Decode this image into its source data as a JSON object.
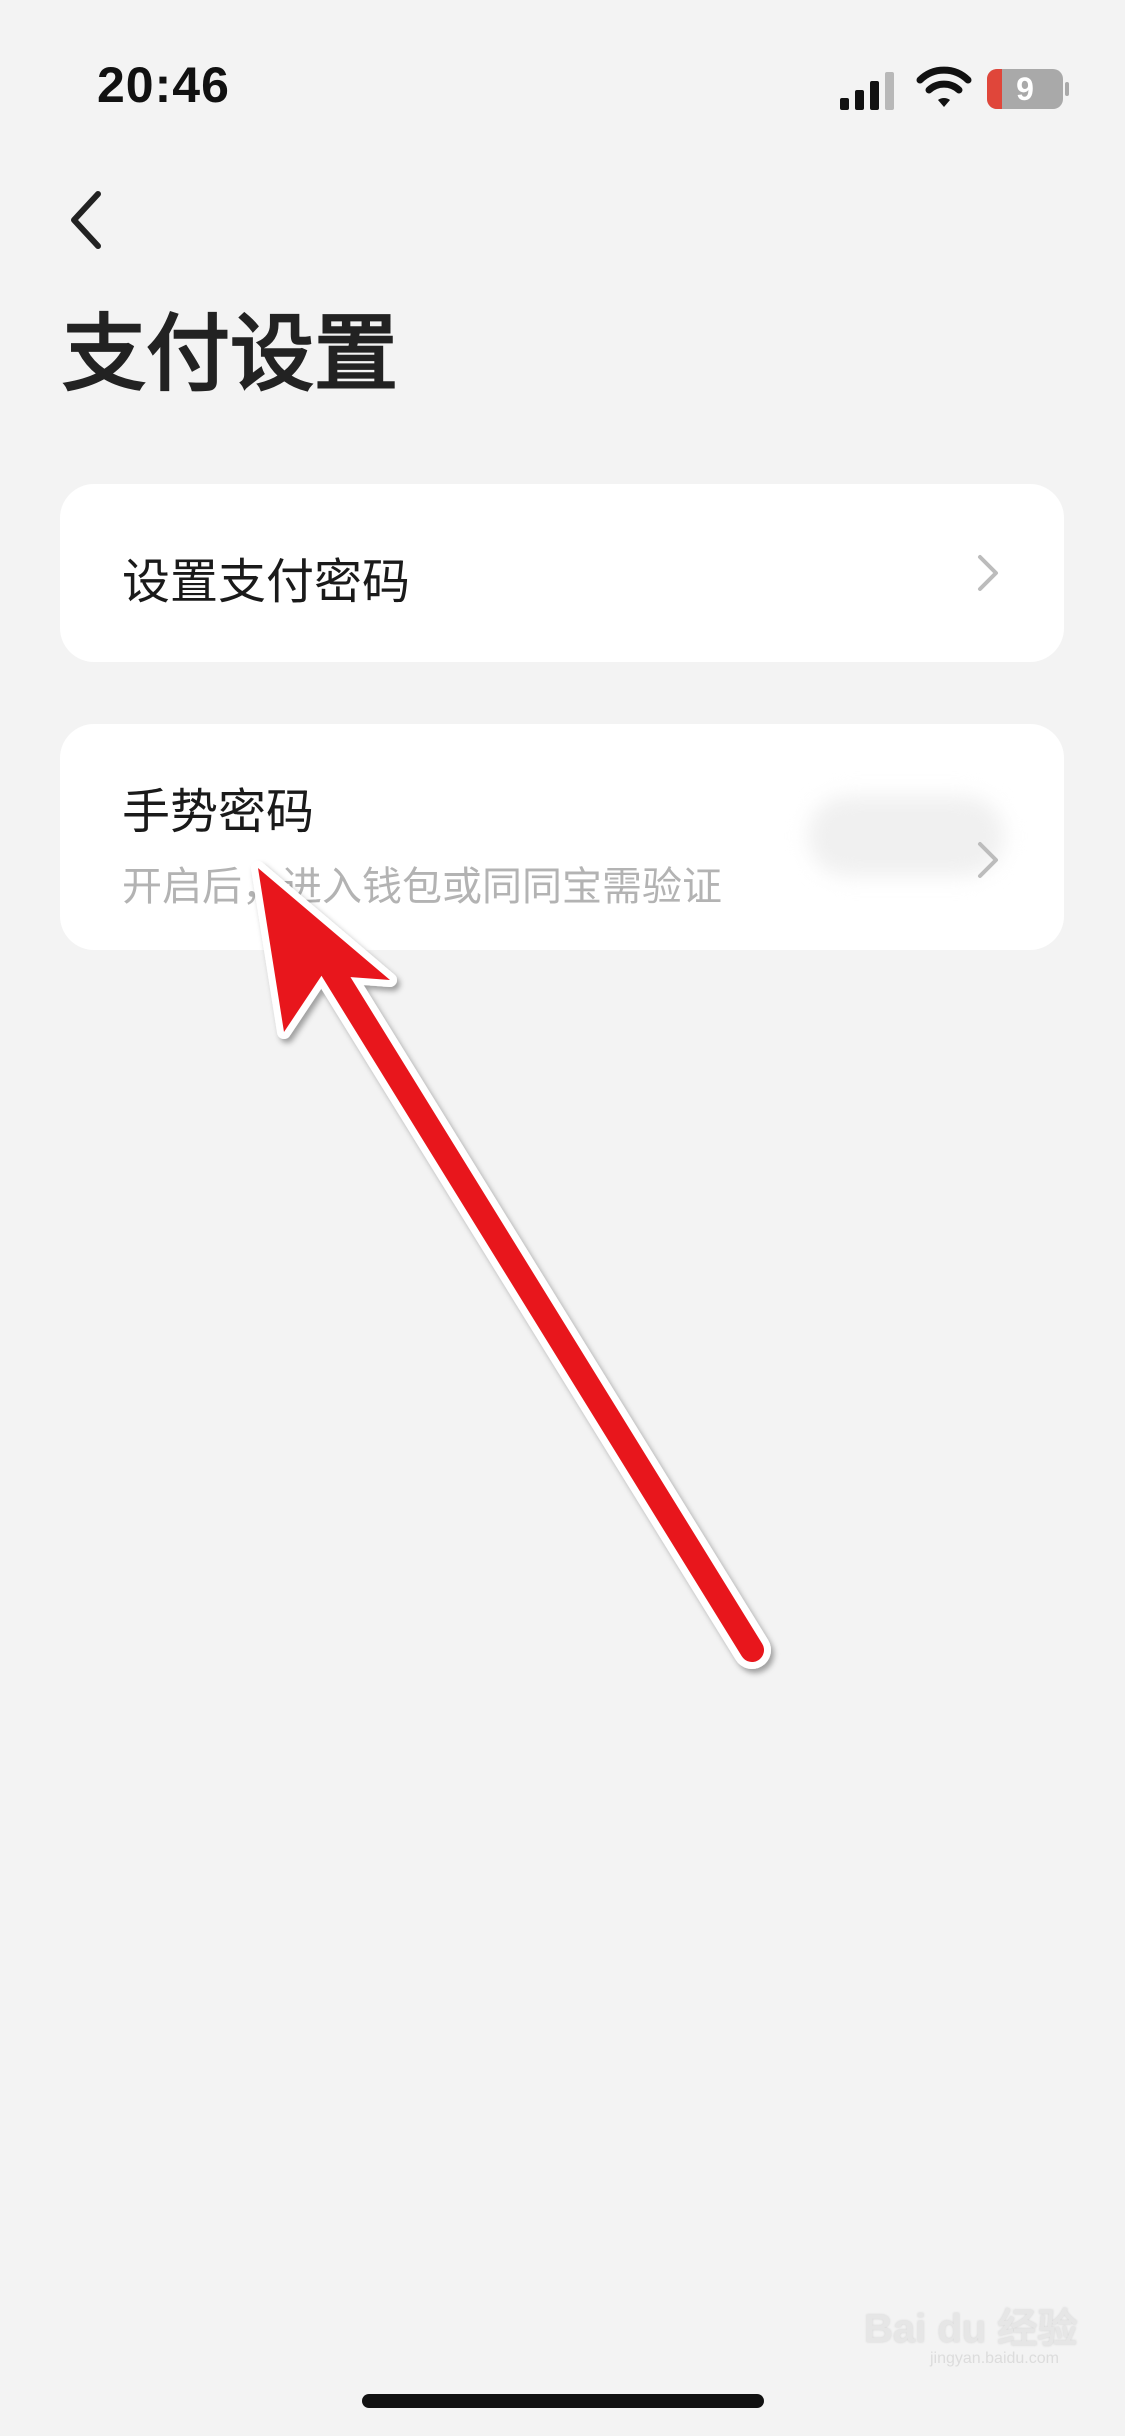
{
  "status_bar": {
    "time": "20:46",
    "battery": "9",
    "icons": [
      "signal-icon",
      "wifi-icon",
      "battery-icon"
    ]
  },
  "nav": {
    "back_icon": "chevron-left-icon"
  },
  "page": {
    "title": "支付设置"
  },
  "settings": [
    {
      "title": "设置支付密码",
      "icon": "chevron-right-icon"
    },
    {
      "title": "手势密码",
      "subtitle": "开启后，进入钱包或同同宝需验证",
      "icon": "chevron-right-icon"
    }
  ],
  "annotation": {
    "color": "#e8141b",
    "icon": "red-arrow-annotation"
  },
  "watermark": {
    "text": "Bai du 经验",
    "sub": "jingyan.baidu.com"
  },
  "colors": {
    "background": "#f3f3f3",
    "card": "#ffffff",
    "subtitle": "#b3b3b3",
    "battery_low": "#e0463a"
  }
}
